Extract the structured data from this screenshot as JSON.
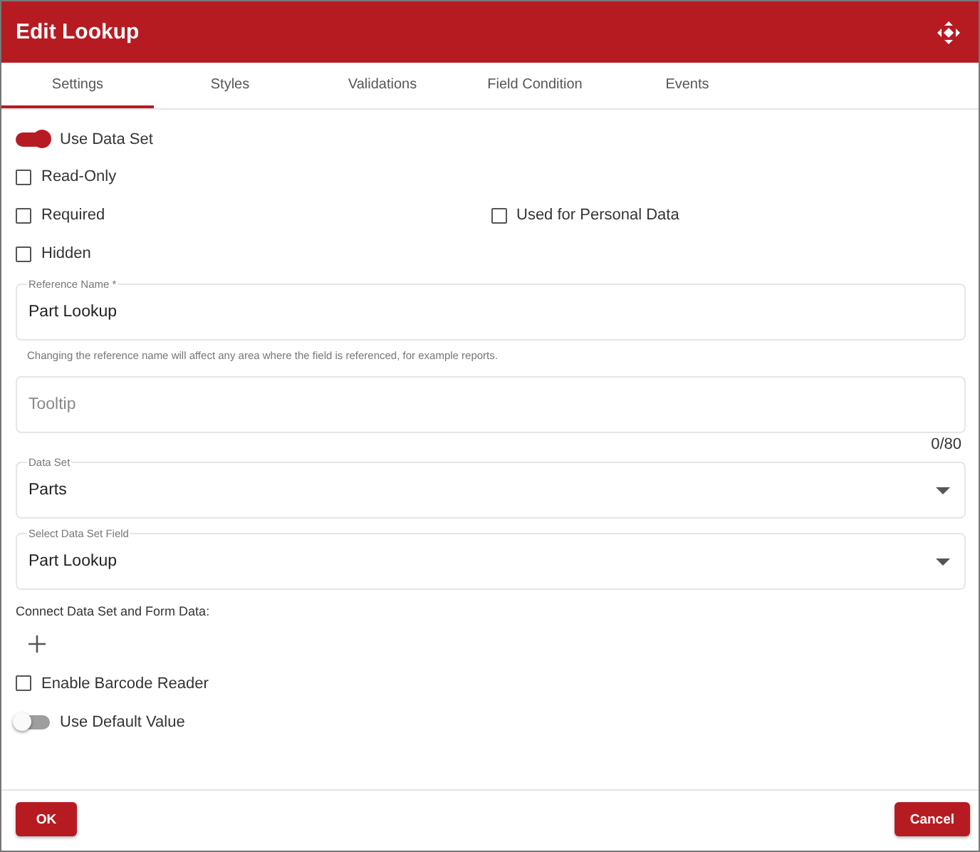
{
  "window": {
    "title": "Edit Lookup"
  },
  "tabs": [
    {
      "label": "Settings",
      "selected": true
    },
    {
      "label": "Styles",
      "selected": false
    },
    {
      "label": "Validations",
      "selected": false
    },
    {
      "label": "Field Condition",
      "selected": false
    },
    {
      "label": "Events",
      "selected": false
    }
  ],
  "option_rows": [
    [
      {
        "kind": "toggle",
        "label": "Use Data Set",
        "checked": true
      }
    ],
    [
      {
        "kind": "checkbox",
        "label": "Read-Only",
        "checked": false
      }
    ],
    [
      {
        "kind": "checkbox",
        "label": "Required",
        "checked": false
      },
      {
        "kind": "checkbox",
        "label": "Used for Personal Data",
        "checked": false
      }
    ],
    [
      {
        "kind": "checkbox",
        "label": "Hidden",
        "checked": false
      }
    ]
  ],
  "fields": [
    {
      "kind": "text",
      "label": "Reference Name *",
      "value": "Part Lookup",
      "helper": "Changing the reference name will affect any area where the field is referenced, for example reports."
    },
    {
      "kind": "text",
      "placeholder": "Tooltip",
      "counter": "0/80"
    },
    {
      "kind": "select",
      "label": "Data Set",
      "value": "Parts"
    },
    {
      "kind": "select",
      "label": "Select Data Set Field",
      "value": "Part Lookup"
    }
  ],
  "connect": {
    "label": "Connect Data Set and Form Data:"
  },
  "bottom_options": [
    {
      "kind": "checkbox",
      "label": "Enable Barcode Reader",
      "checked": false
    },
    {
      "kind": "toggle",
      "label": "Use Default Value",
      "checked": false
    }
  ],
  "buttons": {
    "ok": "OK",
    "cancel": "Cancel"
  }
}
